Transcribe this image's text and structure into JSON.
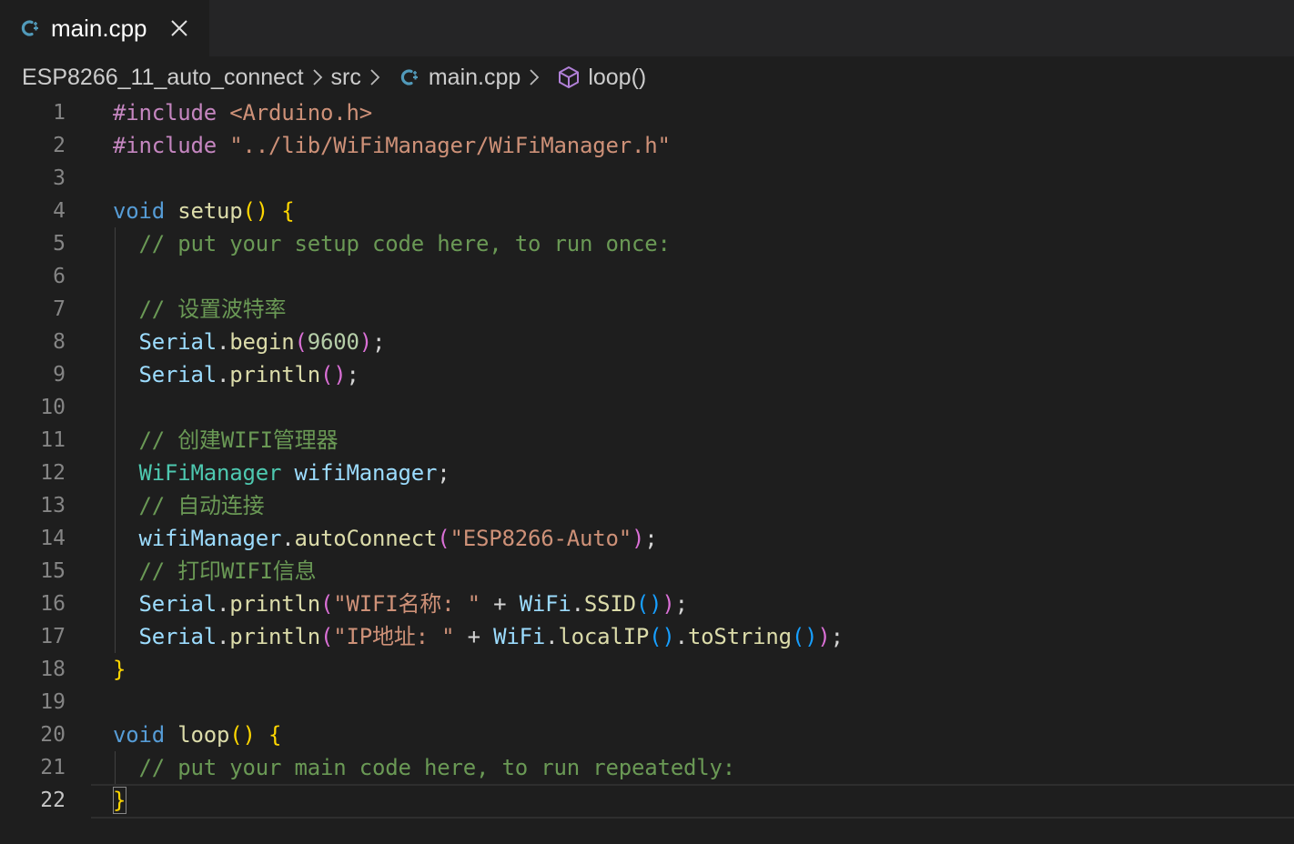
{
  "tab": {
    "title": "main.cpp",
    "icon": "cpp-file-icon",
    "close_icon": "close-icon"
  },
  "breadcrumb": {
    "folder": "ESP8266_11_auto_connect",
    "subfolder": "src",
    "file": "main.cpp",
    "symbol": "loop()"
  },
  "colors": {
    "background": "#1e1e1e",
    "tabbar": "#252526",
    "cpp_icon": "#519aba",
    "symbol_icon": "#b180d7",
    "keyword": "#569cd6",
    "preprocessor": "#c586c0",
    "string": "#ce9178",
    "comment": "#6a9955",
    "function": "#dcdcaa",
    "variable": "#9cdcfe",
    "type": "#4ec9b0",
    "number": "#b5cea8"
  },
  "editor": {
    "active_line": 22,
    "lines": [
      {
        "n": "1",
        "tokens": [
          {
            "t": "#include",
            "c": "kw-pp"
          },
          {
            "t": " ",
            "c": "pl"
          },
          {
            "t": "<Arduino.h>",
            "c": "inc"
          }
        ]
      },
      {
        "n": "2",
        "tokens": [
          {
            "t": "#include",
            "c": "kw-pp"
          },
          {
            "t": " ",
            "c": "pl"
          },
          {
            "t": "\"../lib/WiFiManager/WiFiManager.h\"",
            "c": "inc"
          }
        ]
      },
      {
        "n": "3",
        "tokens": []
      },
      {
        "n": "4",
        "tokens": [
          {
            "t": "void",
            "c": "kw"
          },
          {
            "t": " ",
            "c": "pl"
          },
          {
            "t": "setup",
            "c": "fn"
          },
          {
            "t": "()",
            "c": "b1"
          },
          {
            "t": " ",
            "c": "pl"
          },
          {
            "t": "{",
            "c": "b1"
          }
        ]
      },
      {
        "n": "5",
        "tokens": [
          {
            "t": "  // put your setup code here, to run once:",
            "c": "cm"
          }
        ]
      },
      {
        "n": "6",
        "tokens": []
      },
      {
        "n": "7",
        "tokens": [
          {
            "t": "  // 设置波特率",
            "c": "cm"
          }
        ]
      },
      {
        "n": "8",
        "tokens": [
          {
            "t": "  ",
            "c": "pl"
          },
          {
            "t": "Serial",
            "c": "var"
          },
          {
            "t": ".",
            "c": "pl"
          },
          {
            "t": "begin",
            "c": "fn"
          },
          {
            "t": "(",
            "c": "b2"
          },
          {
            "t": "9600",
            "c": "num"
          },
          {
            "t": ")",
            "c": "b2"
          },
          {
            "t": ";",
            "c": "pl"
          }
        ]
      },
      {
        "n": "9",
        "tokens": [
          {
            "t": "  ",
            "c": "pl"
          },
          {
            "t": "Serial",
            "c": "var"
          },
          {
            "t": ".",
            "c": "pl"
          },
          {
            "t": "println",
            "c": "fn"
          },
          {
            "t": "()",
            "c": "b2"
          },
          {
            "t": ";",
            "c": "pl"
          }
        ]
      },
      {
        "n": "10",
        "tokens": []
      },
      {
        "n": "11",
        "tokens": [
          {
            "t": "  // 创建WIFI管理器",
            "c": "cm"
          }
        ]
      },
      {
        "n": "12",
        "tokens": [
          {
            "t": "  ",
            "c": "pl"
          },
          {
            "t": "WiFiManager",
            "c": "type"
          },
          {
            "t": " ",
            "c": "pl"
          },
          {
            "t": "wifiManager",
            "c": "var"
          },
          {
            "t": ";",
            "c": "pl"
          }
        ]
      },
      {
        "n": "13",
        "tokens": [
          {
            "t": "  // 自动连接",
            "c": "cm"
          }
        ]
      },
      {
        "n": "14",
        "tokens": [
          {
            "t": "  ",
            "c": "pl"
          },
          {
            "t": "wifiManager",
            "c": "var"
          },
          {
            "t": ".",
            "c": "pl"
          },
          {
            "t": "autoConnect",
            "c": "fn"
          },
          {
            "t": "(",
            "c": "b2"
          },
          {
            "t": "\"ESP8266-Auto\"",
            "c": "str"
          },
          {
            "t": ")",
            "c": "b2"
          },
          {
            "t": ";",
            "c": "pl"
          }
        ]
      },
      {
        "n": "15",
        "tokens": [
          {
            "t": "  // 打印WIFI信息",
            "c": "cm"
          }
        ]
      },
      {
        "n": "16",
        "tokens": [
          {
            "t": "  ",
            "c": "pl"
          },
          {
            "t": "Serial",
            "c": "var"
          },
          {
            "t": ".",
            "c": "pl"
          },
          {
            "t": "println",
            "c": "fn"
          },
          {
            "t": "(",
            "c": "b2"
          },
          {
            "t": "\"WIFI名称: \"",
            "c": "str"
          },
          {
            "t": " + ",
            "c": "pl"
          },
          {
            "t": "WiFi",
            "c": "var"
          },
          {
            "t": ".",
            "c": "pl"
          },
          {
            "t": "SSID",
            "c": "fn"
          },
          {
            "t": "()",
            "c": "b3"
          },
          {
            "t": ")",
            "c": "b2"
          },
          {
            "t": ";",
            "c": "pl"
          }
        ]
      },
      {
        "n": "17",
        "tokens": [
          {
            "t": "  ",
            "c": "pl"
          },
          {
            "t": "Serial",
            "c": "var"
          },
          {
            "t": ".",
            "c": "pl"
          },
          {
            "t": "println",
            "c": "fn"
          },
          {
            "t": "(",
            "c": "b2"
          },
          {
            "t": "\"IP地址: \"",
            "c": "str"
          },
          {
            "t": " + ",
            "c": "pl"
          },
          {
            "t": "WiFi",
            "c": "var"
          },
          {
            "t": ".",
            "c": "pl"
          },
          {
            "t": "localIP",
            "c": "fn"
          },
          {
            "t": "()",
            "c": "b3"
          },
          {
            "t": ".",
            "c": "pl"
          },
          {
            "t": "toString",
            "c": "fn"
          },
          {
            "t": "()",
            "c": "b3"
          },
          {
            "t": ")",
            "c": "b2"
          },
          {
            "t": ";",
            "c": "pl"
          }
        ]
      },
      {
        "n": "18",
        "tokens": [
          {
            "t": "}",
            "c": "b1"
          }
        ]
      },
      {
        "n": "19",
        "tokens": []
      },
      {
        "n": "20",
        "tokens": [
          {
            "t": "void",
            "c": "kw"
          },
          {
            "t": " ",
            "c": "pl"
          },
          {
            "t": "loop",
            "c": "fn"
          },
          {
            "t": "()",
            "c": "b1"
          },
          {
            "t": " ",
            "c": "pl"
          },
          {
            "t": "{",
            "c": "b1"
          }
        ]
      },
      {
        "n": "21",
        "tokens": [
          {
            "t": "  // put your main code here, to run repeatedly:",
            "c": "cm"
          }
        ]
      },
      {
        "n": "22",
        "tokens": [
          {
            "t": "}",
            "c": "b1"
          }
        ]
      }
    ]
  }
}
